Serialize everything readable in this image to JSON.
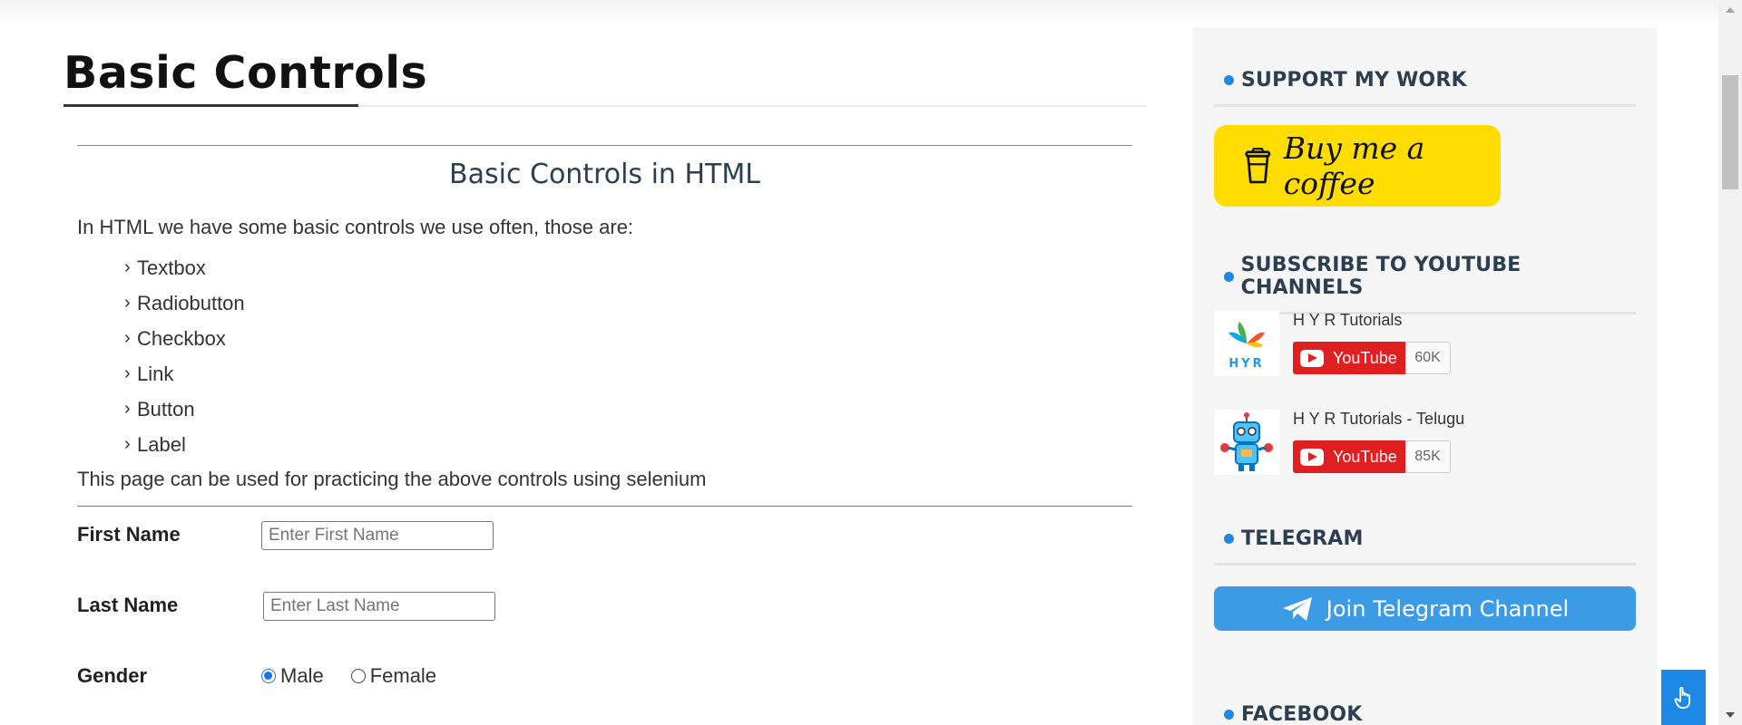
{
  "page": {
    "title": "Basic Controls"
  },
  "section": {
    "heading": "Basic Controls in HTML",
    "intro": "In HTML we have some basic controls we use often, those are:",
    "controls": [
      "Textbox",
      "Radiobutton",
      "Checkbox",
      "Link",
      "Button",
      "Label"
    ],
    "note": "This page can be used for practicing the above controls using selenium"
  },
  "form": {
    "first_name": {
      "label": "First Name",
      "placeholder": "Enter First Name",
      "value": ""
    },
    "last_name": {
      "label": "Last Name",
      "placeholder": "Enter Last Name",
      "value": ""
    },
    "gender": {
      "label": "Gender",
      "options": [
        "Male",
        "Female"
      ],
      "selected": "Male"
    }
  },
  "sidebar": {
    "support": {
      "title": "SUPPORT MY WORK",
      "button_label": "Buy me a coffee"
    },
    "youtube": {
      "title": "SUBSCRIBE TO YOUTUBE CHANNELS",
      "channels": [
        {
          "name": "H Y R Tutorials",
          "button": "YouTube",
          "count": "60K"
        },
        {
          "name": "H Y R Tutorials - Telugu",
          "button": "YouTube",
          "count": "85K"
        }
      ]
    },
    "telegram": {
      "title": "TELEGRAM",
      "button_label": "Join Telegram Channel"
    },
    "facebook": {
      "title": "FACEBOOK"
    }
  },
  "colors": {
    "accent": "#1e88e5",
    "coffee_yellow": "#ffdd00",
    "youtube_red": "#e02020",
    "telegram_blue": "#3b9be5"
  },
  "icons": [
    "coffee-cup-icon",
    "youtube-play-icon",
    "telegram-plane-icon",
    "hand-pointer-icon",
    "chevron-right-icon"
  ]
}
